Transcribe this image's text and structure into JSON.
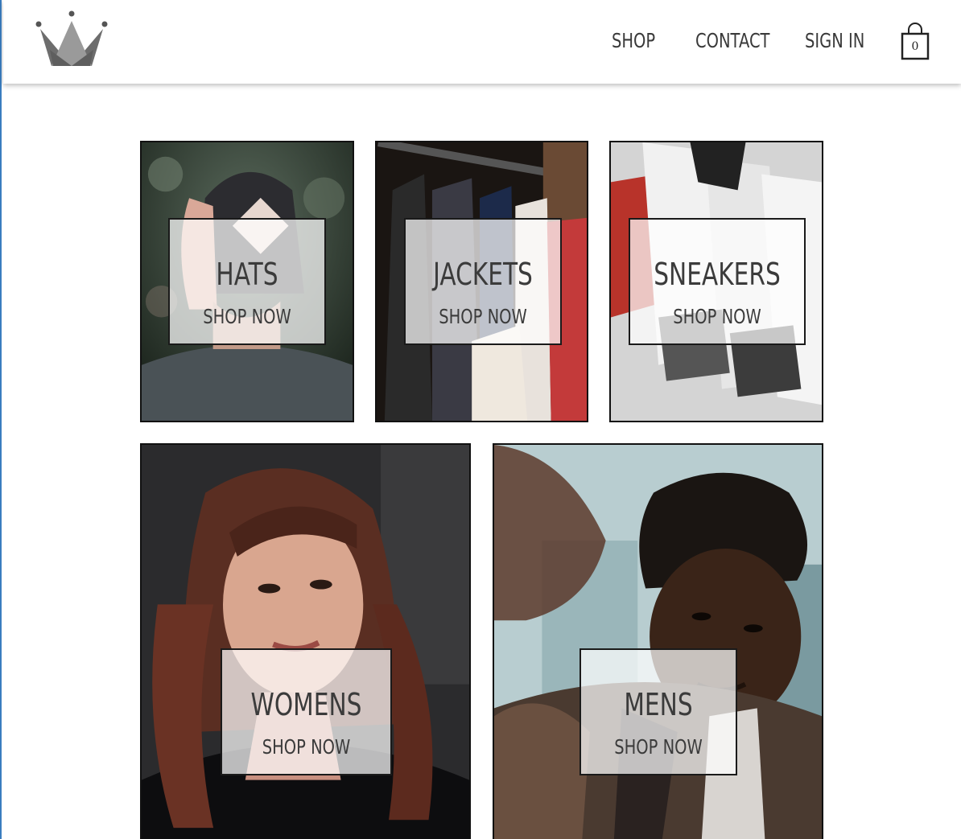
{
  "header": {
    "logo_icon": "crown-icon",
    "nav": {
      "shop": "SHOP",
      "contact": "CONTACT",
      "sign_in": "SIGN IN"
    },
    "cart": {
      "icon": "shopping-bag-icon",
      "count": "0"
    }
  },
  "directory": {
    "categories": [
      {
        "title": "HATS",
        "cta": "SHOP NOW"
      },
      {
        "title": "JACKETS",
        "cta": "SHOP NOW"
      },
      {
        "title": "SNEAKERS",
        "cta": "SHOP NOW"
      },
      {
        "title": "WOMENS",
        "cta": "SHOP NOW"
      },
      {
        "title": "MENS",
        "cta": "SHOP NOW"
      }
    ]
  },
  "colors": {
    "accent_border": "#3a7dbf",
    "text": "#3b3b3b",
    "tile_border": "#111111"
  }
}
